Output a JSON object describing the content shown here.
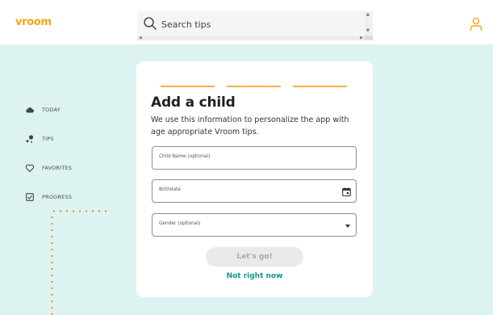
{
  "header": {
    "logo": "vroom",
    "search": {
      "placeholder": "Search tips",
      "value": ""
    }
  },
  "sidebar": {
    "items": [
      {
        "label": "TODAY",
        "icon": "cloud-icon"
      },
      {
        "label": "TIPS",
        "icon": "tips-icon"
      },
      {
        "label": "FAVORITES",
        "icon": "heart-icon"
      },
      {
        "label": "PROGRESS",
        "icon": "checklist-icon"
      }
    ]
  },
  "form": {
    "title": "Add a child",
    "description": "We use this information to personalize the app with age appropriate Vroom tips.",
    "fields": {
      "name_placeholder": "Child Name (optional)",
      "birthdate_placeholder": "Birthdate",
      "gender_placeholder": "Gender (optional)"
    },
    "submit_label": "Let's go!",
    "skip_label": "Not right now"
  },
  "colors": {
    "background": "#dcf3f1",
    "brand_orange": "#f2a51a",
    "accent_teal": "#12978a",
    "dot_orange": "#f08a1c",
    "progress": "#f2b145"
  }
}
